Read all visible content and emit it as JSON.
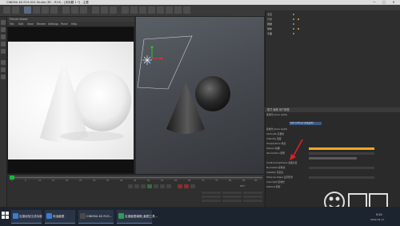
{
  "window": {
    "title": "CINEMA 4D R19.024 Studio (RC - R19) - [未标题 1 *] - 主要",
    "min": "—",
    "max": "□",
    "close": "✕"
  },
  "render_view": {
    "title": "Picture Viewer",
    "menu": [
      "File",
      "Edit",
      "View",
      "Render",
      "Settings",
      "Panel",
      "Help"
    ]
  },
  "timeline": {
    "ticks": [
      "0",
      "5",
      "10",
      "15",
      "20",
      "25",
      "30",
      "35",
      "40",
      "45",
      "50",
      "55",
      "60",
      "65",
      "70",
      "75",
      "80",
      "85",
      "90"
    ],
    "end_frame": "90 F"
  },
  "objects": {
    "rows": [
      "天空",
      "灯光",
      "圆锥",
      "球体",
      "平面"
    ]
  },
  "attributes": {
    "header": "模式 编辑 用户数据",
    "object_label": "区域光 [Area Light]",
    "tab_label": "Light settings [光照设置]",
    "rows": [
      "区域光 [Area Light]",
      "Vectorize 矢量化",
      "Intensity 强度",
      "Temperature 色温",
      "Texture 纹理",
      "Illumination 照明",
      "Surface brightness 表面亮度",
      "Normalize 标准化",
      "Visibility 可见性",
      "Show as shape 显示形状",
      "Area light 区域光",
      "Shadow 阴影"
    ]
  },
  "taskbar": {
    "items": [
      "百度经验生成功能",
      "电话截图",
      "CINEMA 4D R19...",
      "百度截图编辑_截图工具..."
    ],
    "time": "9:30",
    "date": "2022-01-17"
  },
  "colors": {
    "accent": "#19b63d",
    "highlight": "#f5a623",
    "arrow": "#e02020"
  }
}
